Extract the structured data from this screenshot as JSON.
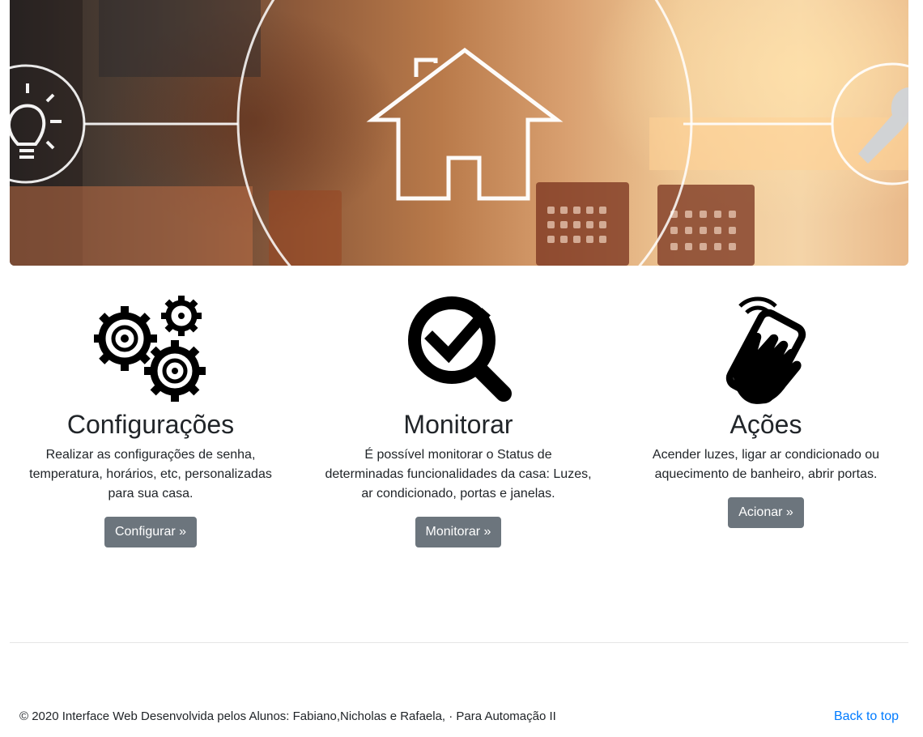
{
  "hero": {
    "icons": [
      "lightbulb-icon",
      "house-icon",
      "wrench-icon"
    ]
  },
  "features": [
    {
      "title": "Configurações",
      "description": "Realizar as configurações de senha, temperatura, horários, etc, personalizadas para sua casa.",
      "button_label": "Configurar »",
      "icon": "gears-icon"
    },
    {
      "title": "Monitorar",
      "description": "É possível monitorar o Status de determinadas funcionalidades da casa: Luzes, ar condicionado, portas e janelas.",
      "button_label": "Monitorar »",
      "icon": "magnifier-check-icon"
    },
    {
      "title": "Ações",
      "description": "Acender luzes, ligar ar condicionado ou aquecimento de banheiro, abrir portas.",
      "button_label": "Acionar »",
      "icon": "phone-in-hand-icon"
    }
  ],
  "footer": {
    "copyright": "© 2020 Interface Web Desenvolvida pelos Alunos: Fabiano,Nicholas e Rafaela, · Para Automação II",
    "back_to_top": "Back to top"
  },
  "colors": {
    "button_bg": "#6c757d",
    "link": "#007bff",
    "text": "#212529"
  }
}
